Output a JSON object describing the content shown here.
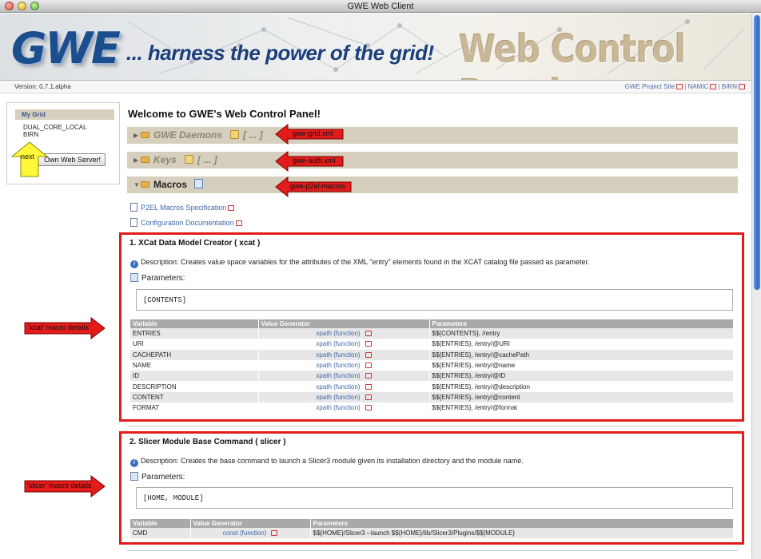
{
  "window": {
    "title": "GWE Web Client"
  },
  "banner": {
    "logo_text": "GWE",
    "tagline": "... harness the power of the grid!",
    "title": "Web Control Panel"
  },
  "version": "Version: 0.7.1.alpha",
  "header_links": [
    "GWE Project Site",
    "NAMIC",
    "BIRN"
  ],
  "sidebar": {
    "header": "My Grid",
    "items": [
      "DUAL_CORE_LOCAL",
      "BIRN"
    ],
    "button_label": "Own Web Server!"
  },
  "main": {
    "welcome": "Welcome to GWE's Web Control Panel!",
    "sections": [
      {
        "name": "GWE Daemons",
        "dots": "[ ... ]",
        "expanded": false
      },
      {
        "name": "Keys",
        "dots": "[ ... ]",
        "expanded": false
      },
      {
        "name": "Macros",
        "expanded": true
      }
    ],
    "doc_links": [
      "P2EL Macros Specification",
      "Configuration Documentation"
    ]
  },
  "macros": [
    {
      "title": "1. XCat Data Model Creator ( xcat )",
      "description": "Description: Creates value space variables for the attributes of the XML \"entry\" elements found in the XCAT catalog file passed as parameter.",
      "params_label": "Parameters:",
      "contents": "[CONTENTS]",
      "columns": [
        "Variable",
        "Value Generator",
        "Parameters"
      ],
      "rows": [
        [
          "ENTRIES",
          "xpath (function)",
          "$${CONTENTS}, //entry"
        ],
        [
          "URI",
          "xpath (function)",
          "$${ENTRIES}, /entry/@URI"
        ],
        [
          "CACHEPATH",
          "xpath (function)",
          "$${ENTRIES}, /entry/@cachePath"
        ],
        [
          "NAME",
          "xpath (function)",
          "$${ENTRIES}, /entry/@name"
        ],
        [
          "ID",
          "xpath (function)",
          "$${ENTRIES}, /entry/@ID"
        ],
        [
          "DESCRIPTION",
          "xpath (function)",
          "$${ENTRIES}, /entry/@description"
        ],
        [
          "CONTENT",
          "xpath (function)",
          "$${ENTRIES}, /entry/@content"
        ],
        [
          "FORMAT",
          "xpath (function)",
          "$${ENTRIES}, /entry/@format"
        ]
      ]
    },
    {
      "title": "2. Slicer Module Base Command ( slicer )",
      "description": "Description: Creates the base command to launch a Slicer3 module given its installation directory and the module name.",
      "params_label": "Parameters:",
      "contents": "[HOME, MODULE]",
      "columns": [
        "Variable",
        "Value Generator",
        "Parameters"
      ],
      "rows": [
        [
          "CMD",
          "const (function)",
          "$${HOME}/Slicer3 --launch $${HOME}/lib/Slicer3/Plugins/$${MODULE}"
        ]
      ]
    }
  ],
  "annotations": {
    "next": "next",
    "gwe_grid": "gwe-grid.xml",
    "gwe_auth": "gwe-auth.xml",
    "gwe_p2el": "gwe-p2el-macros",
    "xcat_details": "'xcat' macro details",
    "slicer_details": "'slicer' macro details"
  },
  "colors": {
    "annotation_red": "#e31b1b",
    "section_bg": "#d6cfbd",
    "link": "#3d67a8",
    "scroll_thumb": "#2d6ad0"
  }
}
